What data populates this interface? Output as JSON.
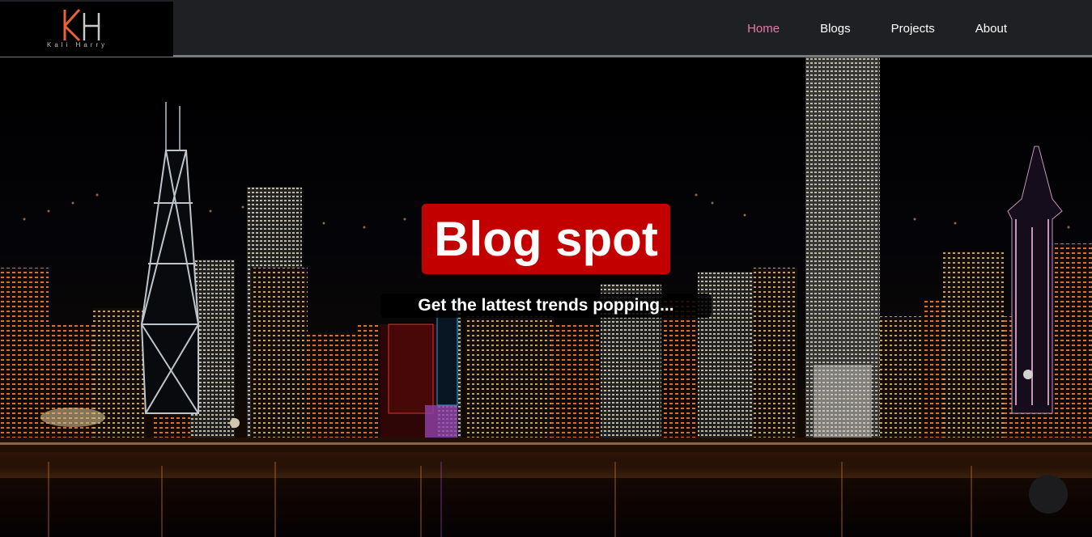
{
  "brand": {
    "logo_initials": "KH",
    "logo_text": "Kali Harry",
    "accent_orange": "#e8603c",
    "accent_gray": "#c9c9c9"
  },
  "nav": {
    "items": [
      {
        "label": "Home",
        "active": true
      },
      {
        "label": "Blogs",
        "active": false
      },
      {
        "label": "Projects",
        "active": false
      },
      {
        "label": "About",
        "active": false
      }
    ],
    "active_color": "#e879a8"
  },
  "hero": {
    "title": "Blog spot",
    "subtitle": "Get the lattest trends popping...",
    "title_bg": "#cc0000",
    "background": "night-city-skyline"
  },
  "fab": {
    "icon": "round-button-icon"
  }
}
